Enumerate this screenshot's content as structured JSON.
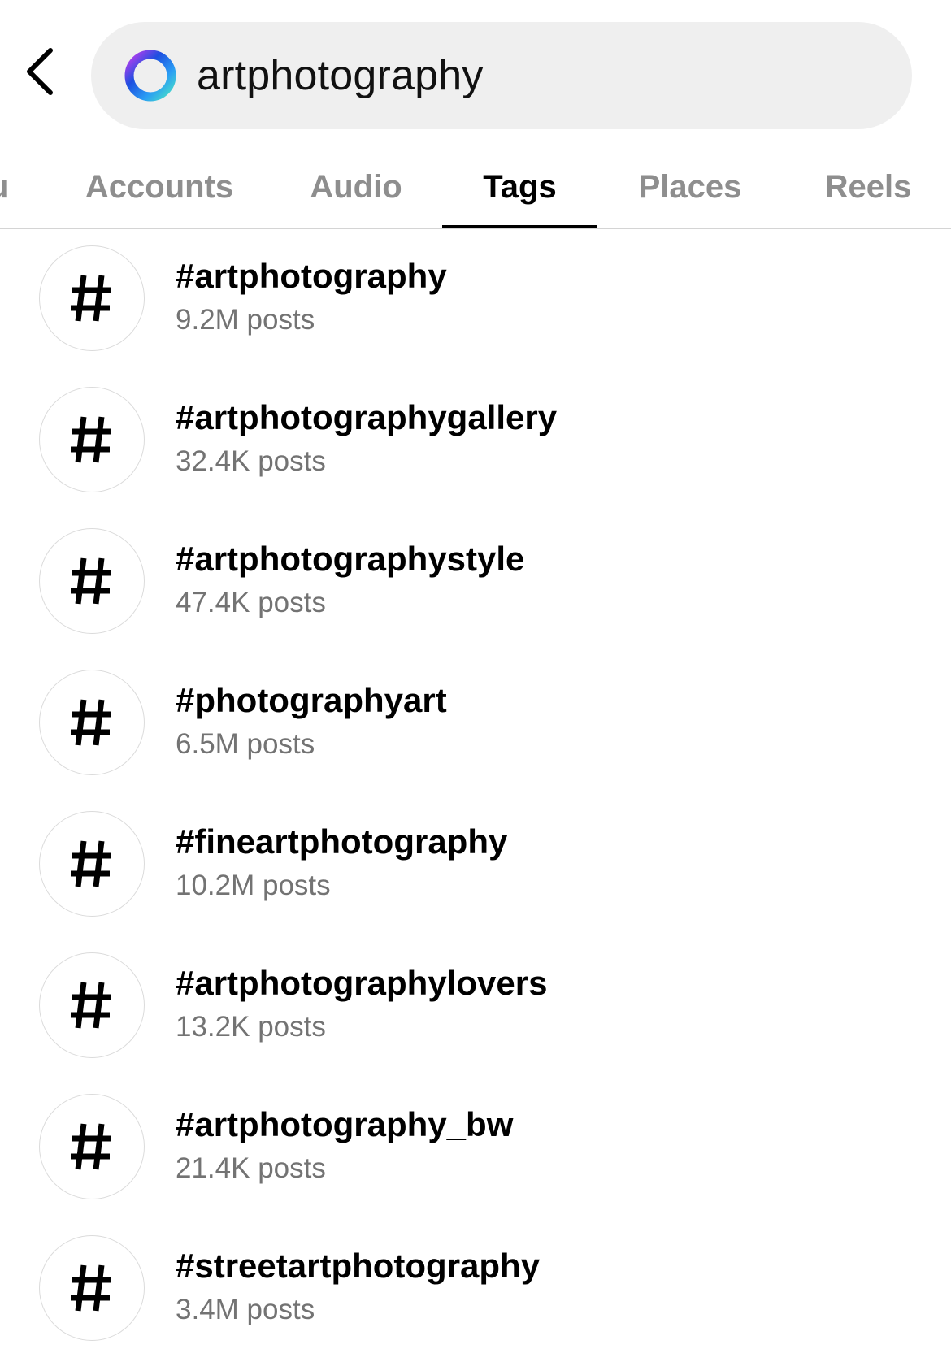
{
  "search": {
    "query": "artphotography",
    "back_icon": "chevron-left-icon",
    "logo_icon": "meta-ai-ring-icon"
  },
  "tabs": [
    {
      "label": "u",
      "active": false
    },
    {
      "label": "Accounts",
      "active": false
    },
    {
      "label": "Audio",
      "active": false
    },
    {
      "label": "Tags",
      "active": true
    },
    {
      "label": "Places",
      "active": false
    },
    {
      "label": "Reels",
      "active": false
    }
  ],
  "results": [
    {
      "tag": "#artphotography",
      "posts": "9.2M posts"
    },
    {
      "tag": "#artphotographygallery",
      "posts": "32.4K posts"
    },
    {
      "tag": "#artphotographystyle",
      "posts": "47.4K posts"
    },
    {
      "tag": "#photographyart",
      "posts": "6.5M posts"
    },
    {
      "tag": "#fineartphotography",
      "posts": "10.2M posts"
    },
    {
      "tag": "#artphotographylovers",
      "posts": "13.2K posts"
    },
    {
      "tag": "#artphotography_bw",
      "posts": "21.4K posts"
    },
    {
      "tag": "#streetartphotography",
      "posts": "3.4M posts"
    }
  ],
  "colors": {
    "search_bg": "#efefef",
    "secondary_text": "#737373",
    "inactive_tab": "#8e8e8e",
    "ring_gradient": [
      "#1e4fe0",
      "#2a9df4",
      "#48e0c8",
      "#c13cf0"
    ]
  }
}
